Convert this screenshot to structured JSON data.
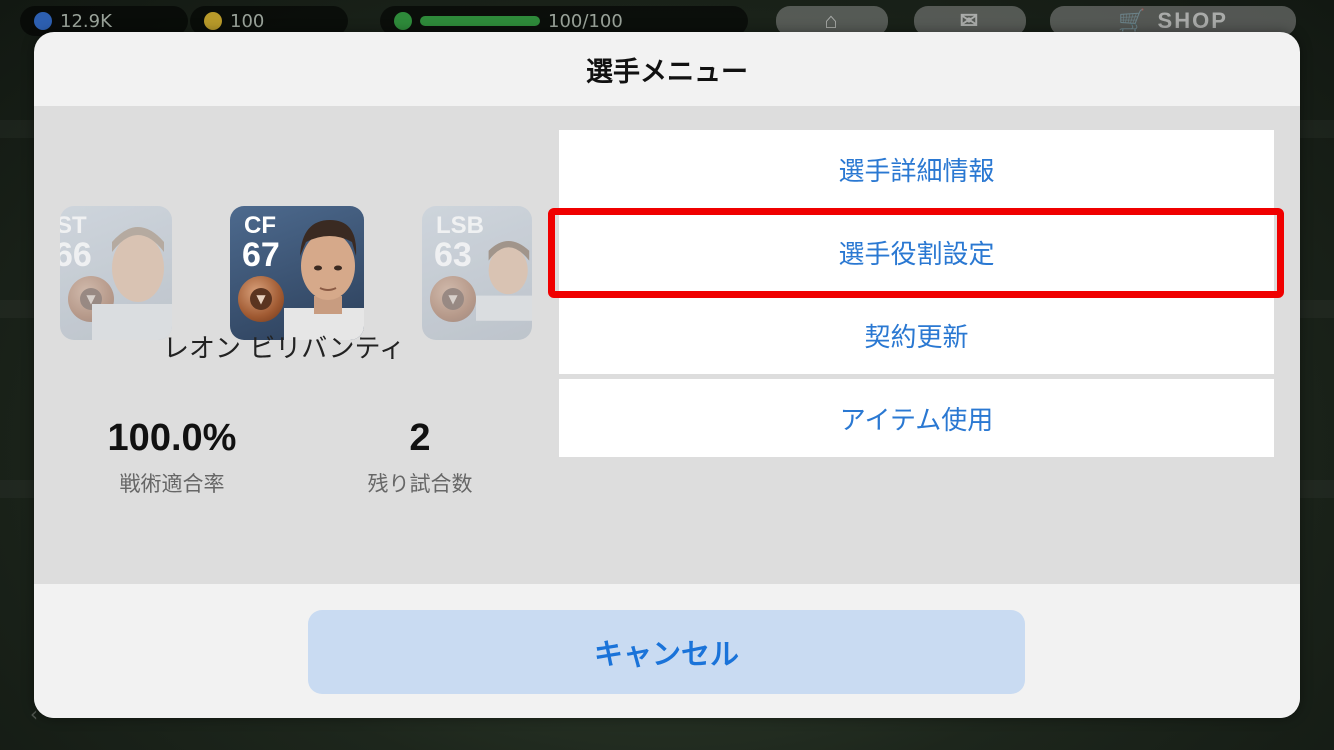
{
  "topbar": {
    "stat1": "12.9K",
    "stat2": "100",
    "stat3": "100/100",
    "shop_label": "SHOP"
  },
  "modal": {
    "title": "選手メニュー",
    "player": {
      "name": "レオン ビリバンティ",
      "main_card": {
        "position": "CF",
        "rating": "67"
      },
      "prev_card": {
        "position": "ST",
        "rating": "66"
      },
      "next_card": {
        "position": "LSB",
        "rating": "63"
      },
      "tactical_fit_value": "100.0%",
      "tactical_fit_label": "戦術適合率",
      "remaining_matches_value": "2",
      "remaining_matches_label": "残り試合数"
    },
    "menu": [
      {
        "label": "選手詳細情報"
      },
      {
        "label": "選手役割設定",
        "highlighted": true
      },
      {
        "label": "契約更新"
      },
      {
        "label": "アイテム使用"
      }
    ],
    "cancel_label": "キャンセル"
  },
  "colors": {
    "accent_blue": "#2a78d2",
    "highlight_red": "#f00000",
    "cancel_bg": "#c9dbf2"
  }
}
